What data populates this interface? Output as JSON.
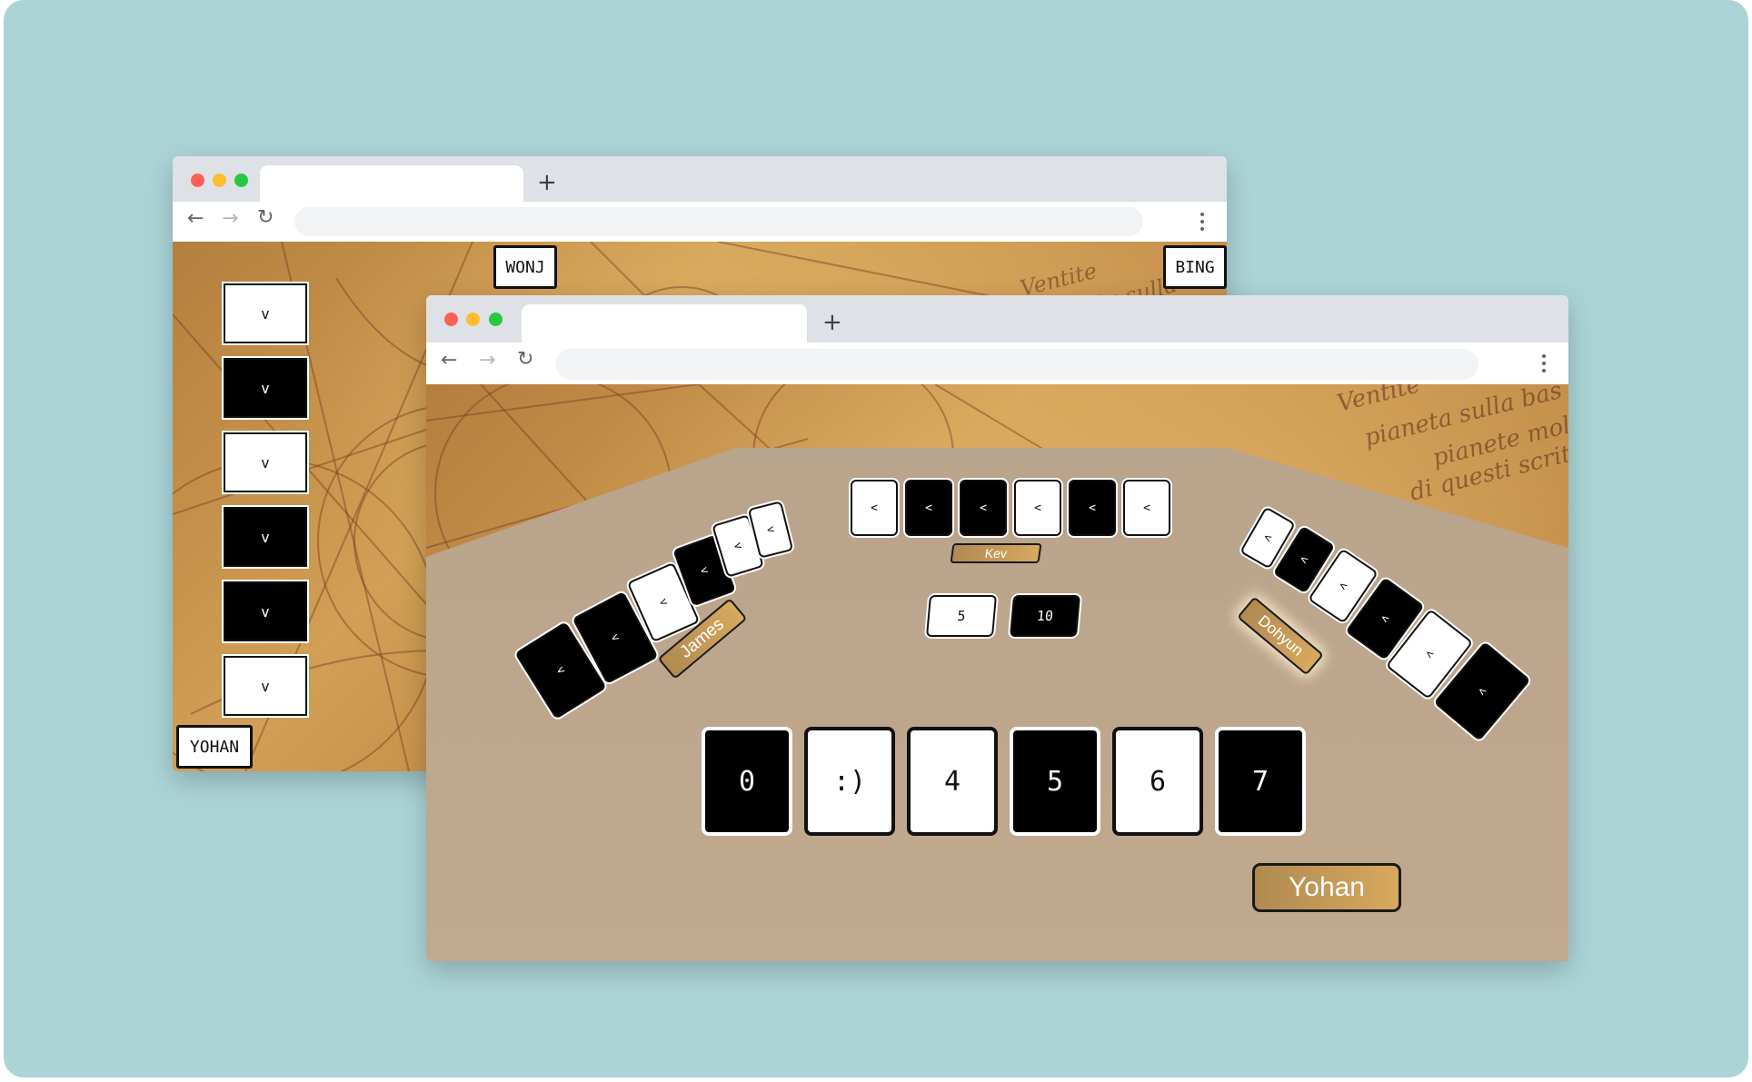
{
  "colors": {
    "backdrop": "#acd4d7",
    "card_black": "#000000",
    "card_white": "#ffffff",
    "nameplate_gold": "#c99a55"
  },
  "back_window": {
    "tab_title": "",
    "address": "",
    "players": {
      "top_left": "WONJ",
      "top_right": "BING",
      "bottom_left": "YOHAN"
    },
    "left_column_cards": [
      {
        "label": "v",
        "color": "white"
      },
      {
        "label": "v",
        "color": "black"
      },
      {
        "label": "v",
        "color": "white"
      },
      {
        "label": "v",
        "color": "black"
      },
      {
        "label": "v",
        "color": "black"
      },
      {
        "label": "v",
        "color": "white"
      }
    ],
    "background_text": [
      "Ventite",
      "pianeta sulla"
    ]
  },
  "front_window": {
    "tab_title": "",
    "address": "",
    "background_text": [
      "Ventite",
      "pianeta sulla bas",
      "pianete molto",
      "di questi scritti"
    ],
    "opponents": {
      "top": {
        "name": "Kev",
        "cards": [
          {
            "label": "<",
            "color": "white"
          },
          {
            "label": "<",
            "color": "black"
          },
          {
            "label": "<",
            "color": "black"
          },
          {
            "label": "<",
            "color": "white"
          },
          {
            "label": "<",
            "color": "black"
          },
          {
            "label": "<",
            "color": "white"
          }
        ]
      },
      "left": {
        "name": "James",
        "cards": [
          {
            "label": "<",
            "color": "black"
          },
          {
            "label": "<",
            "color": "black"
          },
          {
            "label": "<",
            "color": "white"
          },
          {
            "label": "<",
            "color": "black"
          },
          {
            "label": "<",
            "color": "white"
          },
          {
            "label": "<",
            "color": "white"
          }
        ]
      },
      "right": {
        "name": "Dohyun",
        "cards": [
          {
            "label": "<",
            "color": "white"
          },
          {
            "label": "<",
            "color": "black"
          },
          {
            "label": "<",
            "color": "white"
          },
          {
            "label": "<",
            "color": "black"
          },
          {
            "label": "<",
            "color": "white"
          },
          {
            "label": "<",
            "color": "black"
          }
        ]
      }
    },
    "center_cards": [
      {
        "label": "5",
        "color": "white"
      },
      {
        "label": "10",
        "color": "black"
      }
    ],
    "my_hand": [
      {
        "label": "0",
        "color": "black"
      },
      {
        "label": ":)",
        "color": "white"
      },
      {
        "label": "4",
        "color": "white"
      },
      {
        "label": "5",
        "color": "black"
      },
      {
        "label": "6",
        "color": "white"
      },
      {
        "label": "7",
        "color": "black"
      }
    ],
    "my_name": "Yohan"
  }
}
